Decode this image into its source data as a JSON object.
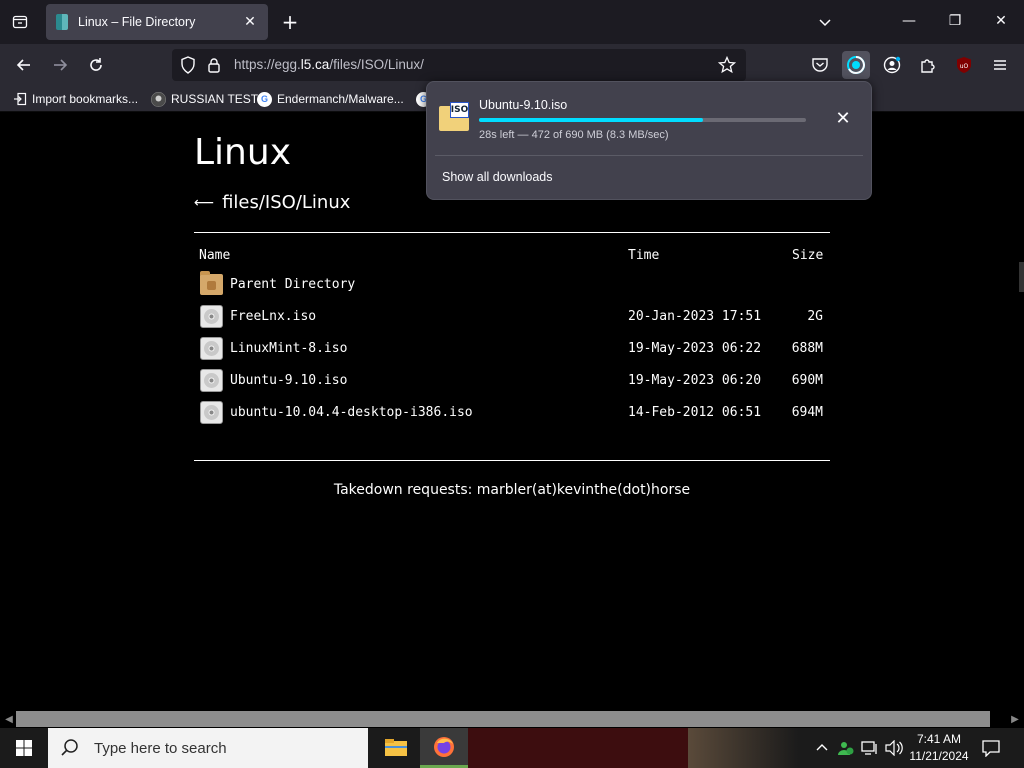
{
  "browser": {
    "tab_title": "Linux – File Directory",
    "tab_close": "✕",
    "new_tab": "+",
    "window_controls": {
      "minimize": "—",
      "maximize": "❐",
      "close": "✕"
    },
    "url_prefix": "https://egg.",
    "url_domain": "l5.ca",
    "url_path": "/files/ISO/Linux/",
    "bookmarks": [
      {
        "label": "Import bookmarks...",
        "icon": "import-icon"
      },
      {
        "label": "RUSSIAN TEST",
        "icon": "github-icon"
      },
      {
        "label": "Endermanch/Malware...",
        "icon": "google-icon"
      }
    ]
  },
  "downloads_panel": {
    "file_name": "Ubuntu-9.10.iso",
    "icon_badge": "ISO",
    "progress_fraction": 0.684,
    "status": "28s left — 472 of 690 MB (8.3 MB/sec)",
    "cancel": "✕",
    "show_all": "Show all downloads"
  },
  "page": {
    "title": "Linux",
    "breadcrumb_arrow": "⟵",
    "breadcrumb": "files/ISO/Linux",
    "columns": {
      "name": "Name",
      "time": "Time",
      "size": "Size"
    },
    "rows": [
      {
        "name": "Parent Directory",
        "time": "",
        "size": "",
        "icon": "folder-icon"
      },
      {
        "name": "FreeLnx.iso",
        "time": "20-Jan-2023 17:51",
        "size": "2G",
        "icon": "disc-icon"
      },
      {
        "name": "LinuxMint-8.iso",
        "time": "19-May-2023 06:22",
        "size": "688M",
        "icon": "disc-icon"
      },
      {
        "name": "Ubuntu-9.10.iso",
        "time": "19-May-2023 06:20",
        "size": "690M",
        "icon": "disc-icon"
      },
      {
        "name": "ubuntu-10.04.4-desktop-i386.iso",
        "time": "14-Feb-2012 06:51",
        "size": "694M",
        "icon": "disc-icon"
      }
    ],
    "footer": "Takedown requests: marbler(at)kevinthe(dot)horse"
  },
  "taskbar": {
    "search_placeholder": "Type here to search",
    "time": "7:41 AM",
    "date": "11/21/2024"
  },
  "colors": {
    "accent": "#00ddff",
    "tab_bg": "#42414d",
    "toolbar_bg": "#2b2a33"
  }
}
